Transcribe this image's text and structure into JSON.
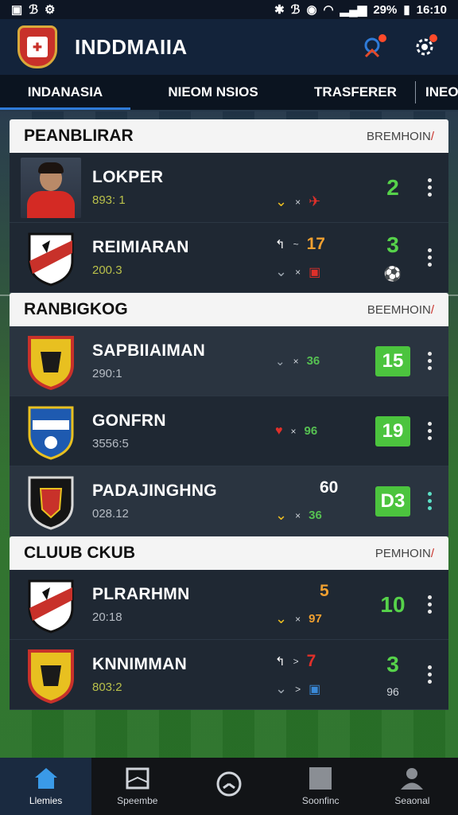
{
  "status_bar": {
    "left_icons": [
      "sim-icon",
      "bluetooth-icon",
      "settings-small-icon"
    ],
    "battery": "29%",
    "time": "16:10"
  },
  "app_bar": {
    "title": "INDDMAIIA"
  },
  "tabs": [
    {
      "label": "INDANASIA",
      "active": true
    },
    {
      "label": "NIEOM NSIOS",
      "active": false
    },
    {
      "label": "TRASFERER",
      "active": false
    },
    {
      "label": "INEO",
      "active": false
    }
  ],
  "sections": [
    {
      "title": "PEANBLIRAR",
      "link_prefix": "BREMHOIN",
      "link_suffix": "/",
      "rows": [
        {
          "name": "LOKPER",
          "sub": "893: 1",
          "mid_top": "",
          "mid_bottom": "×",
          "score": "2",
          "score_sub": ""
        },
        {
          "name": "REIMIARAN",
          "sub": "200.3",
          "mid_top": "17",
          "mid_bottom": "×",
          "score": "3",
          "score_sub": ""
        }
      ]
    },
    {
      "title": "RANBIGKOG",
      "link_prefix": "BEEMHOIN",
      "link_suffix": "/",
      "rows": [
        {
          "name": "SAPBIIAIMAN",
          "sub": "290:1",
          "mid_bottom": "36",
          "score": "15"
        },
        {
          "name": "GONFRN",
          "sub": "3556:5",
          "mid_bottom": "96",
          "score": "19"
        },
        {
          "name": "PADAJINGHNG",
          "sub": "028.12",
          "mid_top": "60",
          "mid_bottom": "36",
          "score": "D3"
        }
      ]
    },
    {
      "title": "CLUUB CKUB",
      "link_prefix": "PEMHOIN",
      "link_suffix": "/",
      "rows": [
        {
          "name": "PLRARHMN",
          "sub": "20:18",
          "mid_top": "5",
          "mid_bottom": "97",
          "score": "10"
        },
        {
          "name": "KNNIMMAN",
          "sub": "803:2",
          "mid_top": "7",
          "mid_bottom": "",
          "score": "3",
          "score_sub": "96"
        }
      ]
    }
  ],
  "bottom_nav": [
    {
      "label": "Llemies",
      "icon": "home-icon",
      "active": true
    },
    {
      "label": "Speembe",
      "icon": "book-icon",
      "active": false
    },
    {
      "label": "",
      "icon": "clock-icon",
      "active": false
    },
    {
      "label": "Soonfinc",
      "icon": "square-icon",
      "active": false
    },
    {
      "label": "Seaonal",
      "icon": "person-icon",
      "active": false
    }
  ],
  "colors": {
    "header_bg": "#13233a",
    "accent_blue": "#2f7bd8",
    "score_green": "#4cc43e",
    "brand_red": "#c8312a"
  }
}
